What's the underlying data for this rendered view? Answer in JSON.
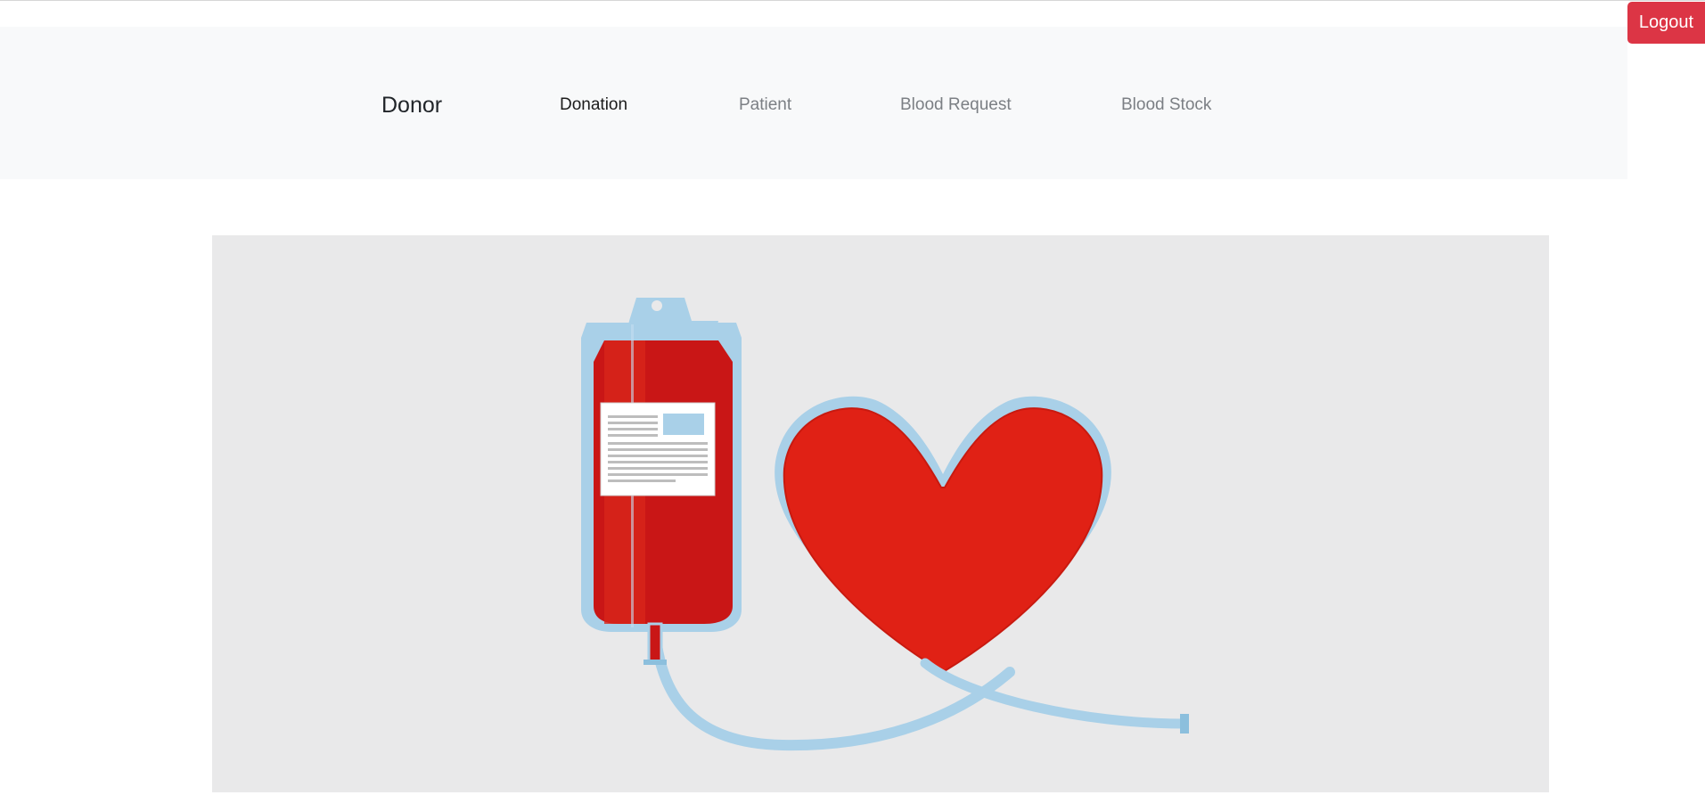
{
  "header": {
    "logout_label": "Logout"
  },
  "navbar": {
    "brand": "Donor",
    "links": [
      {
        "label": "Donation",
        "state": "active"
      },
      {
        "label": "Patient",
        "state": "inactive"
      },
      {
        "label": "Blood Request",
        "state": "inactive"
      },
      {
        "label": "Blood Stock",
        "state": "inactive"
      }
    ]
  },
  "hero": {
    "illustration": "blood-bag-heart-illustration"
  },
  "colors": {
    "logout_bg": "#dc3545",
    "navbar_bg": "#f8f9fa",
    "hero_bg": "#e9e9ea",
    "blood_red": "#e02115",
    "tube_blue": "#a9d0e8"
  }
}
